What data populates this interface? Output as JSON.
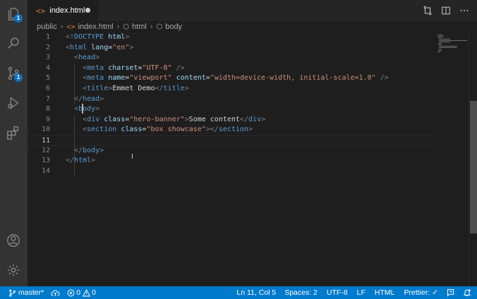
{
  "activity_bar": {
    "items": [
      {
        "name": "explorer",
        "icon": "files-icon",
        "badge": "1"
      },
      {
        "name": "search",
        "icon": "search-icon"
      },
      {
        "name": "source-control",
        "icon": "source-control-icon",
        "badge": "1"
      },
      {
        "name": "run-debug",
        "icon": "run-debug-icon"
      },
      {
        "name": "extensions",
        "icon": "extensions-icon"
      }
    ],
    "bottom": [
      {
        "name": "accounts",
        "icon": "account-icon"
      },
      {
        "name": "manage",
        "icon": "gear-icon"
      }
    ]
  },
  "tab": {
    "icon": "html-file-icon",
    "icon_glyph": "<>",
    "label": "index.html",
    "dirty": true
  },
  "breadcrumb": {
    "items": [
      "public",
      "index.html",
      "html",
      "body"
    ]
  },
  "editor": {
    "current_line": 11,
    "lines": [
      {
        "n": "1",
        "tokens": [
          [
            "br",
            "<!"
          ],
          [
            "tag",
            "DOCTYPE"
          ],
          [
            "txt",
            " "
          ],
          [
            "attr",
            "html"
          ],
          [
            "br",
            ">"
          ]
        ]
      },
      {
        "n": "2",
        "tokens": [
          [
            "br",
            "<"
          ],
          [
            "tag",
            "html"
          ],
          [
            "txt",
            " "
          ],
          [
            "attr",
            "lang"
          ],
          [
            "txt",
            "="
          ],
          [
            "str",
            "\"en\""
          ],
          [
            "br",
            ">"
          ]
        ]
      },
      {
        "n": "3",
        "tokens": [
          [
            "txt",
            "  "
          ],
          [
            "br",
            "<"
          ],
          [
            "tag",
            "head"
          ],
          [
            "br",
            ">"
          ]
        ]
      },
      {
        "n": "4",
        "tokens": [
          [
            "txt",
            "    "
          ],
          [
            "br",
            "<"
          ],
          [
            "tag",
            "meta"
          ],
          [
            "txt",
            " "
          ],
          [
            "attr",
            "charset"
          ],
          [
            "txt",
            "="
          ],
          [
            "str",
            "\"UTF-8\""
          ],
          [
            "txt",
            " "
          ],
          [
            "br",
            "/>"
          ]
        ]
      },
      {
        "n": "5",
        "tokens": [
          [
            "txt",
            "    "
          ],
          [
            "br",
            "<"
          ],
          [
            "tag",
            "meta"
          ],
          [
            "txt",
            " "
          ],
          [
            "attr",
            "name"
          ],
          [
            "txt",
            "="
          ],
          [
            "str",
            "\"viewport\""
          ],
          [
            "txt",
            " "
          ],
          [
            "attr",
            "content"
          ],
          [
            "txt",
            "="
          ],
          [
            "str",
            "\"width=device-width, initial-scale=1.0\""
          ],
          [
            "txt",
            " "
          ],
          [
            "br",
            "/>"
          ]
        ]
      },
      {
        "n": "6",
        "tokens": [
          [
            "txt",
            "    "
          ],
          [
            "br",
            "<"
          ],
          [
            "tag",
            "title"
          ],
          [
            "br",
            ">"
          ],
          [
            "txt",
            "Emmet Demo"
          ],
          [
            "br",
            "</"
          ],
          [
            "tag",
            "title"
          ],
          [
            "br",
            ">"
          ]
        ]
      },
      {
        "n": "7",
        "tokens": [
          [
            "txt",
            "  "
          ],
          [
            "br",
            "</"
          ],
          [
            "tag",
            "head"
          ],
          [
            "br",
            ">"
          ]
        ]
      },
      {
        "n": "8",
        "tokens": [
          [
            "txt",
            "  "
          ],
          [
            "br",
            "<"
          ],
          [
            "tag",
            "body"
          ],
          [
            "br",
            ">"
          ]
        ]
      },
      {
        "n": "9",
        "tokens": [
          [
            "txt",
            "    "
          ],
          [
            "br",
            "<"
          ],
          [
            "tag",
            "div"
          ],
          [
            "txt",
            " "
          ],
          [
            "attr",
            "class"
          ],
          [
            "txt",
            "="
          ],
          [
            "str",
            "\"hero-banner\""
          ],
          [
            "br",
            ">"
          ],
          [
            "txt",
            "Some content"
          ],
          [
            "br",
            "</"
          ],
          [
            "tag",
            "div"
          ],
          [
            "br",
            ">"
          ]
        ]
      },
      {
        "n": "10",
        "tokens": [
          [
            "txt",
            "    "
          ],
          [
            "br",
            "<"
          ],
          [
            "tag",
            "section"
          ],
          [
            "txt",
            " "
          ],
          [
            "attr",
            "class"
          ],
          [
            "txt",
            "="
          ],
          [
            "str",
            "\"box showcase\""
          ],
          [
            "br",
            "></"
          ],
          [
            "tag",
            "section"
          ],
          [
            "br",
            ">"
          ]
        ]
      },
      {
        "n": "11",
        "tokens": [
          [
            "txt",
            "    "
          ]
        ]
      },
      {
        "n": "12",
        "tokens": [
          [
            "txt",
            "  "
          ],
          [
            "br",
            "</"
          ],
          [
            "tag",
            "body"
          ],
          [
            "br",
            ">"
          ]
        ]
      },
      {
        "n": "13",
        "tokens": [
          [
            "br",
            "</"
          ],
          [
            "tag",
            "html"
          ],
          [
            "br",
            ">"
          ]
        ]
      },
      {
        "n": "14",
        "tokens": []
      }
    ]
  },
  "statusbar": {
    "branch": "master*",
    "errors": "0",
    "warnings": "0",
    "cursor_pos": "Ln 11, Col 5",
    "indent": "Spaces: 2",
    "encoding": "UTF-8",
    "eol": "LF",
    "language": "HTML",
    "formatter": "Prettier: ✓"
  },
  "colors": {
    "activity_bg": "#333333",
    "editor_bg": "#1e1e1e",
    "statusbar_bg": "#007acc",
    "tag": "#569cd6",
    "attr": "#9cdcfe",
    "string": "#ce9178",
    "badge": "#0e70c0"
  }
}
